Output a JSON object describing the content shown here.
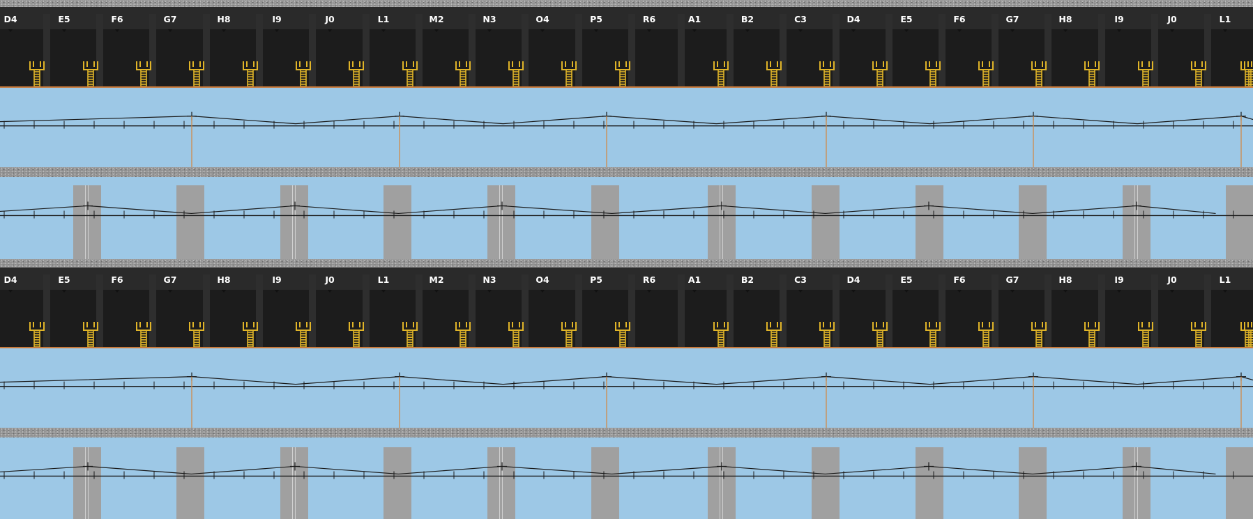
{
  "bay_labels": [
    "D4",
    "E5",
    "F6",
    "G7",
    "H8",
    "I9",
    "J0",
    "L1",
    "M2",
    "N3",
    "O4",
    "P5",
    "R6",
    "A1",
    "B2",
    "C3",
    "D4",
    "E5",
    "F6",
    "G7",
    "H8",
    "I9",
    "J0",
    "L1"
  ],
  "stair_flags": [
    true,
    true,
    true,
    true,
    true,
    true,
    true,
    true,
    true,
    true,
    true,
    true,
    false,
    true,
    true,
    true,
    true,
    true,
    true,
    true,
    true,
    true,
    true,
    true
  ],
  "colors": {
    "sky": "#9dc8e6",
    "platform": "#1c1c1c",
    "platform_header": "#2a2a2a",
    "stair": "#e0b428",
    "edge": "#c87a3c",
    "pillar": "#a0a0a0",
    "wire": "#1a1a1a",
    "pole": "#d08a4a"
  },
  "icons": {
    "bay_marker": "triangle-pin-icon",
    "stair": "stairs-icon"
  }
}
